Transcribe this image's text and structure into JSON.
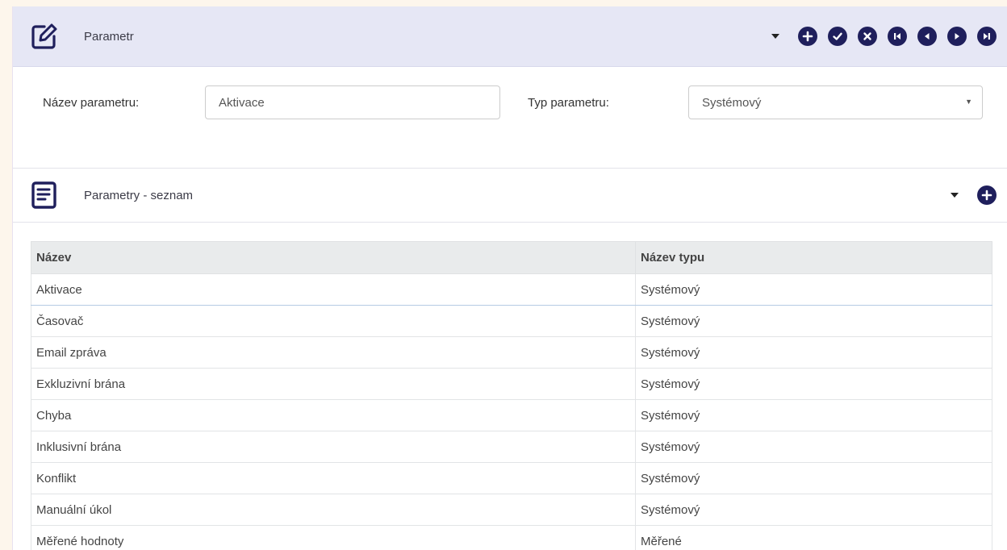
{
  "panel1": {
    "title": "Parametr",
    "actions": [
      "add-icon",
      "confirm-icon",
      "cancel-icon",
      "first-icon",
      "previous-icon",
      "next-icon",
      "last-icon"
    ]
  },
  "form": {
    "name_label": "Název parametru:",
    "name_value": "Aktivace",
    "type_label": "Typ parametru:",
    "type_value": "Systémový"
  },
  "panel2": {
    "title": "Parametry - seznam"
  },
  "table": {
    "headers": [
      "Název",
      "Název typu"
    ],
    "rows": [
      [
        "Aktivace",
        "Systémový"
      ],
      [
        "Časovač",
        "Systémový"
      ],
      [
        "Email zpráva",
        "Systémový"
      ],
      [
        "Exkluzivní brána",
        "Systémový"
      ],
      [
        "Chyba",
        "Systémový"
      ],
      [
        "Inklusivní brána",
        "Systémový"
      ],
      [
        "Konflikt",
        "Systémový"
      ],
      [
        "Manuální úkol",
        "Systémový"
      ],
      [
        "Měřené hodnoty",
        "Měřené"
      ]
    ]
  },
  "colors": {
    "header_bg": "#e6e7f5",
    "accent": "#1f1f5c"
  }
}
